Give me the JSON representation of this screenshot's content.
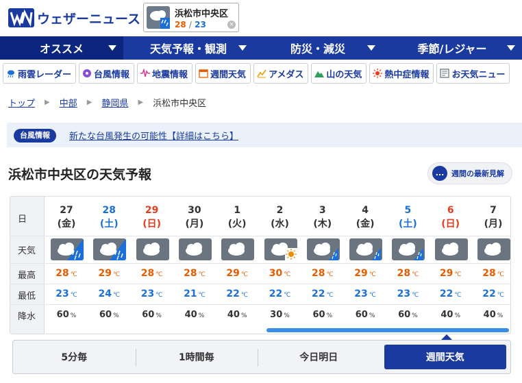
{
  "header": {
    "logo_mark": "WN",
    "logo_text": "ウェザーニュース",
    "location": {
      "name": "浜松市中央区",
      "temp_high": "28",
      "temp_sep": "/",
      "temp_low": "23",
      "close": "×"
    }
  },
  "mainnav": [
    {
      "label": "オススメ",
      "active": true
    },
    {
      "label": "天気予報・観測",
      "active": false
    },
    {
      "label": "防災・減災",
      "active": false
    },
    {
      "label": "季節/レジャー",
      "active": false
    }
  ],
  "subnav": [
    {
      "label": "雨雲レーダー",
      "icon": "rain-radar-icon",
      "color": "#1a6fd8"
    },
    {
      "label": "台風情報",
      "icon": "typhoon-icon",
      "color": "#8a4fd8"
    },
    {
      "label": "地震情報",
      "icon": "seismic-wave-icon",
      "color": "#d83a8a"
    },
    {
      "label": "週間天気",
      "icon": "calendar-icon",
      "color": "#e65c00"
    },
    {
      "label": "アメダス",
      "icon": "chart-icon",
      "color": "#e6a000"
    },
    {
      "label": "山の天気",
      "icon": "mountain-icon",
      "color": "#2aa05a"
    },
    {
      "label": "熱中症情報",
      "icon": "sun-icon",
      "color": "#e63c1e"
    },
    {
      "label": "お天気ニュー",
      "icon": "news-icon",
      "color": "#6b7580"
    }
  ],
  "breadcrumb": {
    "items": [
      "トップ",
      "中部",
      "静岡県"
    ],
    "current": "浜松市中央区"
  },
  "banner": {
    "tag": "台風情報",
    "text": "新たな台風発生の可能性【詳細はこちら】"
  },
  "title": "浜松市中央区の天気予報",
  "latest_button": {
    "label": "週間の最新見解",
    "icon": "..."
  },
  "week": {
    "row_labels": {
      "day": "日",
      "weather": "天気",
      "high": "最高",
      "low": "最低",
      "pop": "降水"
    },
    "temp_unit": "℃",
    "pop_unit": "%",
    "days": [
      {
        "date": "27",
        "wd": "(金)",
        "kind": "wkd",
        "icon": "cloud-rain",
        "high": "28",
        "low": "23",
        "pop": "60"
      },
      {
        "date": "28",
        "wd": "(土)",
        "kind": "sat",
        "icon": "cloud-rain",
        "high": "29",
        "low": "24",
        "pop": "60"
      },
      {
        "date": "29",
        "wd": "(日)",
        "kind": "sun",
        "icon": "cloud",
        "high": "28",
        "low": "23",
        "pop": "60"
      },
      {
        "date": "30",
        "wd": "(月)",
        "kind": "wkd",
        "icon": "cloud",
        "high": "28",
        "low": "21",
        "pop": "40"
      },
      {
        "date": "1",
        "wd": "(火)",
        "kind": "wkd",
        "icon": "cloud",
        "high": "29",
        "low": "22",
        "pop": "40"
      },
      {
        "date": "2",
        "wd": "(水)",
        "kind": "wkd",
        "icon": "cloud-sun",
        "high": "30",
        "low": "22",
        "pop": "30"
      },
      {
        "date": "3",
        "wd": "(木)",
        "kind": "wkd",
        "icon": "cloud-rain-small",
        "high": "28",
        "low": "22",
        "pop": "60"
      },
      {
        "date": "4",
        "wd": "(金)",
        "kind": "wkd",
        "icon": "cloud-rain-small",
        "high": "29",
        "low": "23",
        "pop": "60"
      },
      {
        "date": "5",
        "wd": "(土)",
        "kind": "sat",
        "icon": "cloud-rain-small",
        "high": "28",
        "low": "23",
        "pop": "60"
      },
      {
        "date": "6",
        "wd": "(日)",
        "kind": "sun",
        "icon": "cloud",
        "high": "29",
        "low": "22",
        "pop": "40"
      },
      {
        "date": "7",
        "wd": "(月)",
        "kind": "wkd",
        "icon": "cloud",
        "high": "28",
        "low": "22",
        "pop": "40"
      }
    ]
  },
  "tabs": [
    {
      "label": "5分毎",
      "active": false
    },
    {
      "label": "1時間毎",
      "active": false
    },
    {
      "label": "今日明日",
      "active": false
    },
    {
      "label": "週間天気",
      "active": true
    }
  ],
  "colors": {
    "brand": "#1a3aa0",
    "high": "#e65c00",
    "low": "#1a6fd8",
    "sunday": "#e63c1e",
    "saturday": "#1a6fd8"
  }
}
